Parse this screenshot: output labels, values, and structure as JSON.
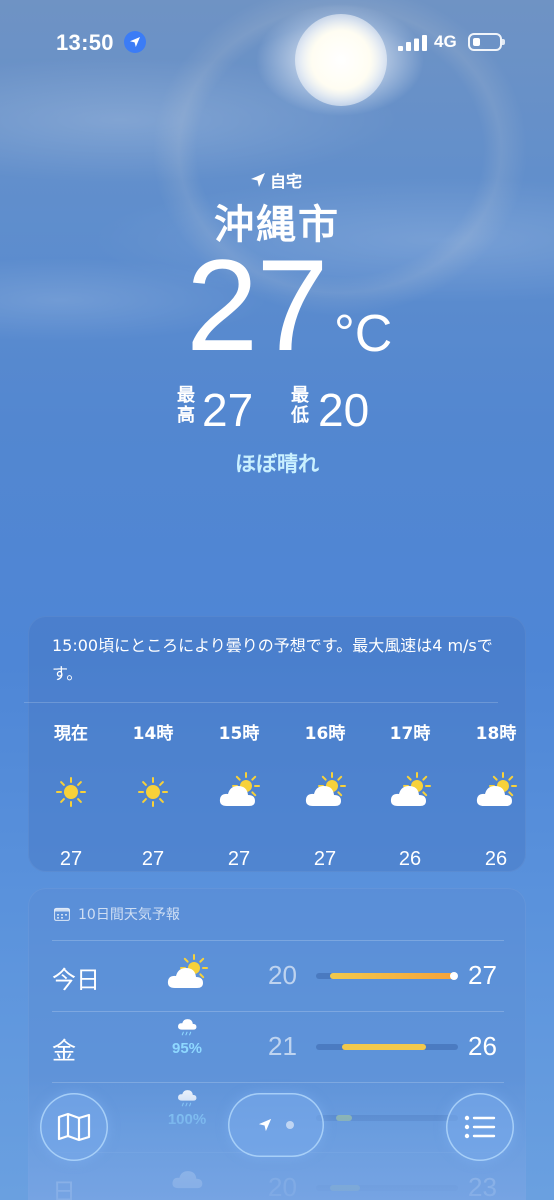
{
  "status_bar": {
    "time": "13:50",
    "network": "4G",
    "battery_level": 0.25
  },
  "location": {
    "label": "自宅",
    "city": "沖縄市"
  },
  "current": {
    "temperature": "27",
    "unit": "°C",
    "high_label": "最\n高",
    "high": "27",
    "low_label": "最\n低",
    "low": "20",
    "condition": "ほぼ晴れ"
  },
  "hourly": {
    "summary": "15:00頃にところにより曇りの予想です。最大風速は4 m/sです。",
    "items": [
      {
        "label": "現在",
        "icon": "sun-icon",
        "temp": "27"
      },
      {
        "label": "14時",
        "icon": "sun-icon",
        "temp": "27"
      },
      {
        "label": "15時",
        "icon": "partly-cloudy-icon",
        "temp": "27"
      },
      {
        "label": "16時",
        "icon": "partly-cloudy-icon",
        "temp": "27"
      },
      {
        "label": "17時",
        "icon": "partly-cloudy-icon",
        "temp": "26"
      },
      {
        "label": "18時",
        "icon": "partly-cloudy-icon",
        "temp": "26"
      }
    ]
  },
  "daily": {
    "title": "10日間天気予報",
    "items": [
      {
        "day": "今日",
        "icon": "partly-cloudy-icon",
        "precip": "",
        "low": "20",
        "high": "27"
      },
      {
        "day": "金",
        "icon": "rain-cloud-icon",
        "precip": "95%",
        "low": "21",
        "high": "26"
      },
      {
        "day": "",
        "icon": "rain-cloud-icon",
        "precip": "100%",
        "low": "",
        "high": ""
      },
      {
        "day": "日",
        "icon": "cloud-icon",
        "precip": "",
        "low": "20",
        "high": "23"
      }
    ]
  },
  "toolbar": {
    "left": "map-icon",
    "center": "location-arrow-icon",
    "right": "list-icon"
  },
  "colors": {
    "accent_condition": "#c9f0ff",
    "precip": "#8ed8ff",
    "bar_warm": "#f5a33a",
    "bar_yellow": "#f2c94c"
  }
}
